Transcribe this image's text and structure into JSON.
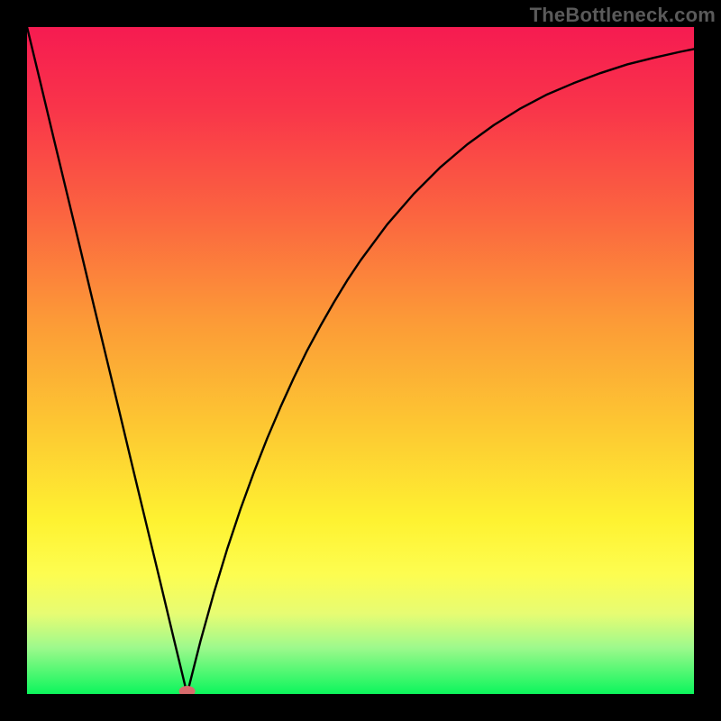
{
  "watermark": "TheBottleneck.com",
  "gradient_stops": [
    {
      "offset": 0.0,
      "color": "#f61b51"
    },
    {
      "offset": 0.12,
      "color": "#f9344a"
    },
    {
      "offset": 0.28,
      "color": "#fb6440"
    },
    {
      "offset": 0.44,
      "color": "#fc9a37"
    },
    {
      "offset": 0.6,
      "color": "#fdc832"
    },
    {
      "offset": 0.74,
      "color": "#fef231"
    },
    {
      "offset": 0.82,
      "color": "#fdfd50"
    },
    {
      "offset": 0.88,
      "color": "#e7fc73"
    },
    {
      "offset": 0.93,
      "color": "#9ef98c"
    },
    {
      "offset": 1.0,
      "color": "#0cf65c"
    }
  ],
  "chart_data": {
    "type": "line",
    "title": "",
    "xlabel": "",
    "ylabel": "",
    "xlim": [
      0,
      100
    ],
    "ylim": [
      0,
      100
    ],
    "marker": {
      "x": 24,
      "y": 0,
      "color": "#d86b6c"
    },
    "series": [
      {
        "name": "curve",
        "color": "#000000",
        "x": [
          0,
          2,
          4,
          6,
          8,
          10,
          12,
          14,
          16,
          18,
          20,
          22,
          24,
          26,
          28,
          30,
          32,
          34,
          36,
          38,
          40,
          42,
          44,
          46,
          48,
          50,
          54,
          58,
          62,
          66,
          70,
          74,
          78,
          82,
          86,
          90,
          94,
          98,
          100
        ],
        "y": [
          100,
          91.7,
          83.3,
          75.0,
          66.7,
          58.3,
          50.0,
          41.7,
          33.3,
          25.0,
          16.7,
          8.3,
          0.0,
          7.9,
          15.1,
          21.7,
          27.7,
          33.2,
          38.3,
          43.0,
          47.4,
          51.5,
          55.2,
          58.7,
          62.0,
          65.0,
          70.4,
          75.0,
          79.0,
          82.4,
          85.3,
          87.8,
          89.9,
          91.6,
          93.1,
          94.4,
          95.4,
          96.3,
          96.7
        ]
      }
    ]
  }
}
